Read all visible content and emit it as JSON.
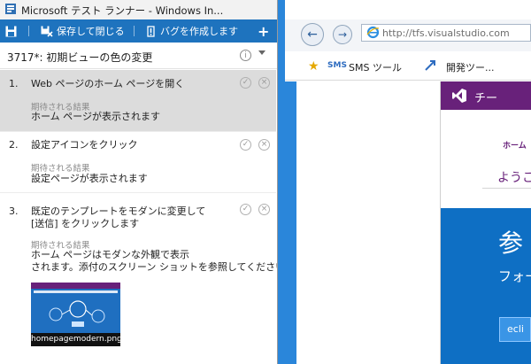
{
  "window": {
    "title": "Microsoft テスト ランナー - Windows In..."
  },
  "toolbar": {
    "save_close_label": "保存して閉じる",
    "create_bug_label": "バグを作成します"
  },
  "test_case": {
    "title": "3717*: 初期ビューの色の変更"
  },
  "steps": [
    {
      "number": "1.",
      "action": "Web ページのホーム ページを開く",
      "expected_label": "期待される結果",
      "expected": "ホーム ページが表示されます"
    },
    {
      "number": "2.",
      "action": "設定アイコンをクリック",
      "expected_label": "期待される結果",
      "expected": "設定ページが表示されます"
    },
    {
      "number": "3.",
      "action_line1": "既定のテンプレートをモダンに変更して",
      "action_line2": "[送信] をクリックします",
      "expected_label": "期待される結果",
      "expected_line1": "ホーム ページはモダンな外観で表示",
      "expected_line2": "されます。添付のスクリーン ショットを参照してください。",
      "attachment": "homepagemodern.png"
    }
  ],
  "browser": {
    "address": "http://tfs.visualstudio.com",
    "favorites": [
      {
        "badge": "SMS",
        "label": "SMS ツール"
      },
      {
        "label": "開発ツー..."
      }
    ],
    "page": {
      "header_text": "チー",
      "nav_link": "ホーム",
      "welcome": "ようこ",
      "hero_title": "参",
      "hero_sub": "フォー",
      "button": "ecli"
    }
  },
  "colors": {
    "toolbar": "#1e73be",
    "selected_step": "#dcdcdc",
    "desktop": "#2a86da",
    "vs_purple": "#68217a",
    "hero_blue": "#0e6fc4"
  }
}
